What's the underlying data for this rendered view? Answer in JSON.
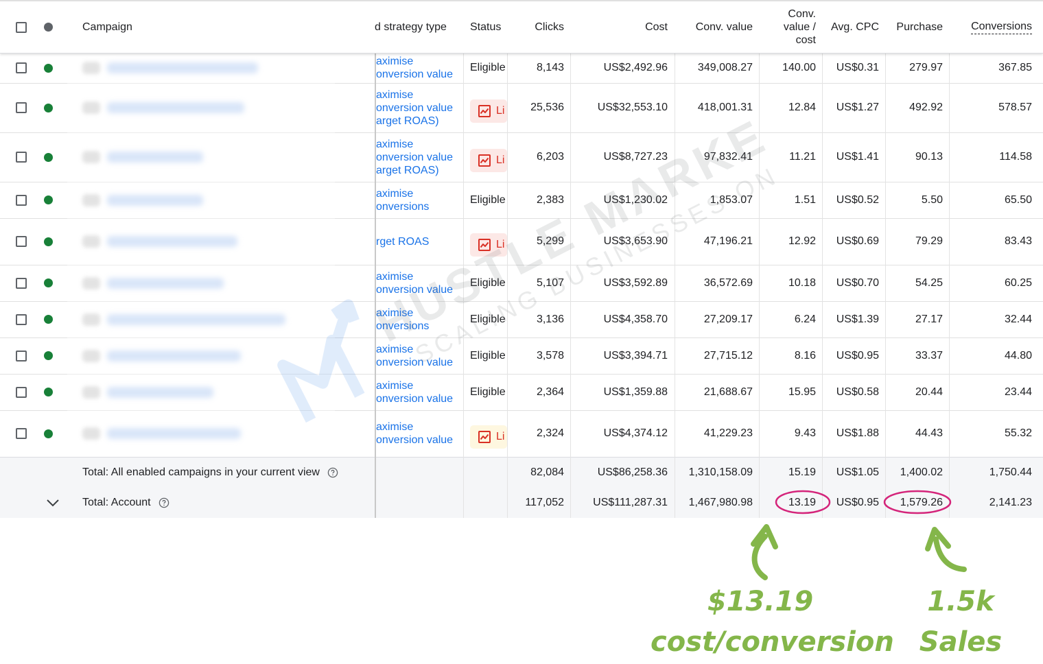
{
  "columns": {
    "campaign": "Campaign",
    "bid_strategy": "d strategy type",
    "status": "Status",
    "clicks": "Clicks",
    "cost": "Cost",
    "conv_value": "Conv. value",
    "conv_value_cost": [
      "Conv.",
      "value /",
      "cost"
    ],
    "avg_cpc": "Avg. CPC",
    "purchase": "Purchase",
    "conversions": "Conversions"
  },
  "rows": [
    {
      "bid": [
        "aximise",
        "onversion value"
      ],
      "status": "Eligible",
      "status_type": "text",
      "clicks": "8,143",
      "cost": "US$2,492.96",
      "conv_value": "349,008.27",
      "ratio": "140.00",
      "cpc": "US$0.31",
      "purchase": "279.97",
      "conversions": "367.85"
    },
    {
      "bid": [
        "aximise",
        "onversion value",
        "arget ROAS)"
      ],
      "status": "Li",
      "status_type": "limited",
      "clicks": "25,536",
      "cost": "US$32,553.10",
      "conv_value": "418,001.31",
      "ratio": "12.84",
      "cpc": "US$1.27",
      "purchase": "492.92",
      "conversions": "578.57"
    },
    {
      "bid": [
        "aximise",
        "onversion value",
        "arget ROAS)"
      ],
      "status": "Li",
      "status_type": "limited",
      "clicks": "6,203",
      "cost": "US$8,727.23",
      "conv_value": "97,832.41",
      "ratio": "11.21",
      "cpc": "US$1.41",
      "purchase": "90.13",
      "conversions": "114.58"
    },
    {
      "bid": [
        "aximise",
        "onversions"
      ],
      "status": "Eligible",
      "status_type": "text",
      "clicks": "2,383",
      "cost": "US$1,230.02",
      "conv_value": "1,853.07",
      "ratio": "1.51",
      "cpc": "US$0.52",
      "purchase": "5.50",
      "conversions": "65.50"
    },
    {
      "bid": [
        "rget ROAS"
      ],
      "status": "Li",
      "status_type": "limited",
      "clicks": "5,299",
      "cost": "US$3,653.90",
      "conv_value": "47,196.21",
      "ratio": "12.92",
      "cpc": "US$0.69",
      "purchase": "79.29",
      "conversions": "83.43"
    },
    {
      "bid": [
        "aximise",
        "onversion value"
      ],
      "status": "Eligible",
      "status_type": "text",
      "clicks": "5,107",
      "cost": "US$3,592.89",
      "conv_value": "36,572.69",
      "ratio": "10.18",
      "cpc": "US$0.70",
      "purchase": "54.25",
      "conversions": "60.25"
    },
    {
      "bid": [
        "aximise",
        "onversions"
      ],
      "status": "Eligible",
      "status_type": "text",
      "clicks": "3,136",
      "cost": "US$4,358.70",
      "conv_value": "27,209.17",
      "ratio": "6.24",
      "cpc": "US$1.39",
      "purchase": "27.17",
      "conversions": "32.44"
    },
    {
      "bid": [
        "aximise",
        "onversion value"
      ],
      "status": "Eligible",
      "status_type": "text",
      "clicks": "3,578",
      "cost": "US$3,394.71",
      "conv_value": "27,715.12",
      "ratio": "8.16",
      "cpc": "US$0.95",
      "purchase": "33.37",
      "conversions": "44.80"
    },
    {
      "bid": [
        "aximise",
        "onversion value"
      ],
      "status": "Eligible",
      "status_type": "text",
      "clicks": "2,364",
      "cost": "US$1,359.88",
      "conv_value": "21,688.67",
      "ratio": "15.95",
      "cpc": "US$0.58",
      "purchase": "20.44",
      "conversions": "23.44"
    },
    {
      "bid": [
        "aximise",
        "onversion value"
      ],
      "status": "Li",
      "status_type": "limited-light",
      "clicks": "2,324",
      "cost": "US$4,374.12",
      "conv_value": "41,229.23",
      "ratio": "9.43",
      "cpc": "US$1.88",
      "purchase": "44.43",
      "conversions": "55.32"
    }
  ],
  "totals": {
    "enabled": {
      "label": "Total: All enabled campaigns in your current view",
      "clicks": "82,084",
      "cost": "US$86,258.36",
      "conv_value": "1,310,158.09",
      "ratio": "15.19",
      "cpc": "US$1.05",
      "purchase": "1,400.02",
      "conversions": "1,750.44"
    },
    "account": {
      "label": "Total: Account",
      "clicks": "117,052",
      "cost": "US$111,287.31",
      "conv_value": "1,467,980.98",
      "ratio": "13.19",
      "cpc": "US$0.95",
      "purchase": "1,579.26",
      "conversions": "2,141.23"
    }
  },
  "watermark": {
    "line1": "HUSTLE MARKETERS",
    "line2": "SCALING BUSINESSES ONLINE"
  },
  "annotations": {
    "left": [
      "$13.19",
      "cost/conversion"
    ],
    "right": [
      "1.5k",
      "Sales"
    ],
    "highlight_color": "#d4247a",
    "text_color": "#84b64a"
  },
  "colors": {
    "link": "#1a73e8",
    "enabled_dot": "#188038",
    "limited_red": "#d93025"
  }
}
